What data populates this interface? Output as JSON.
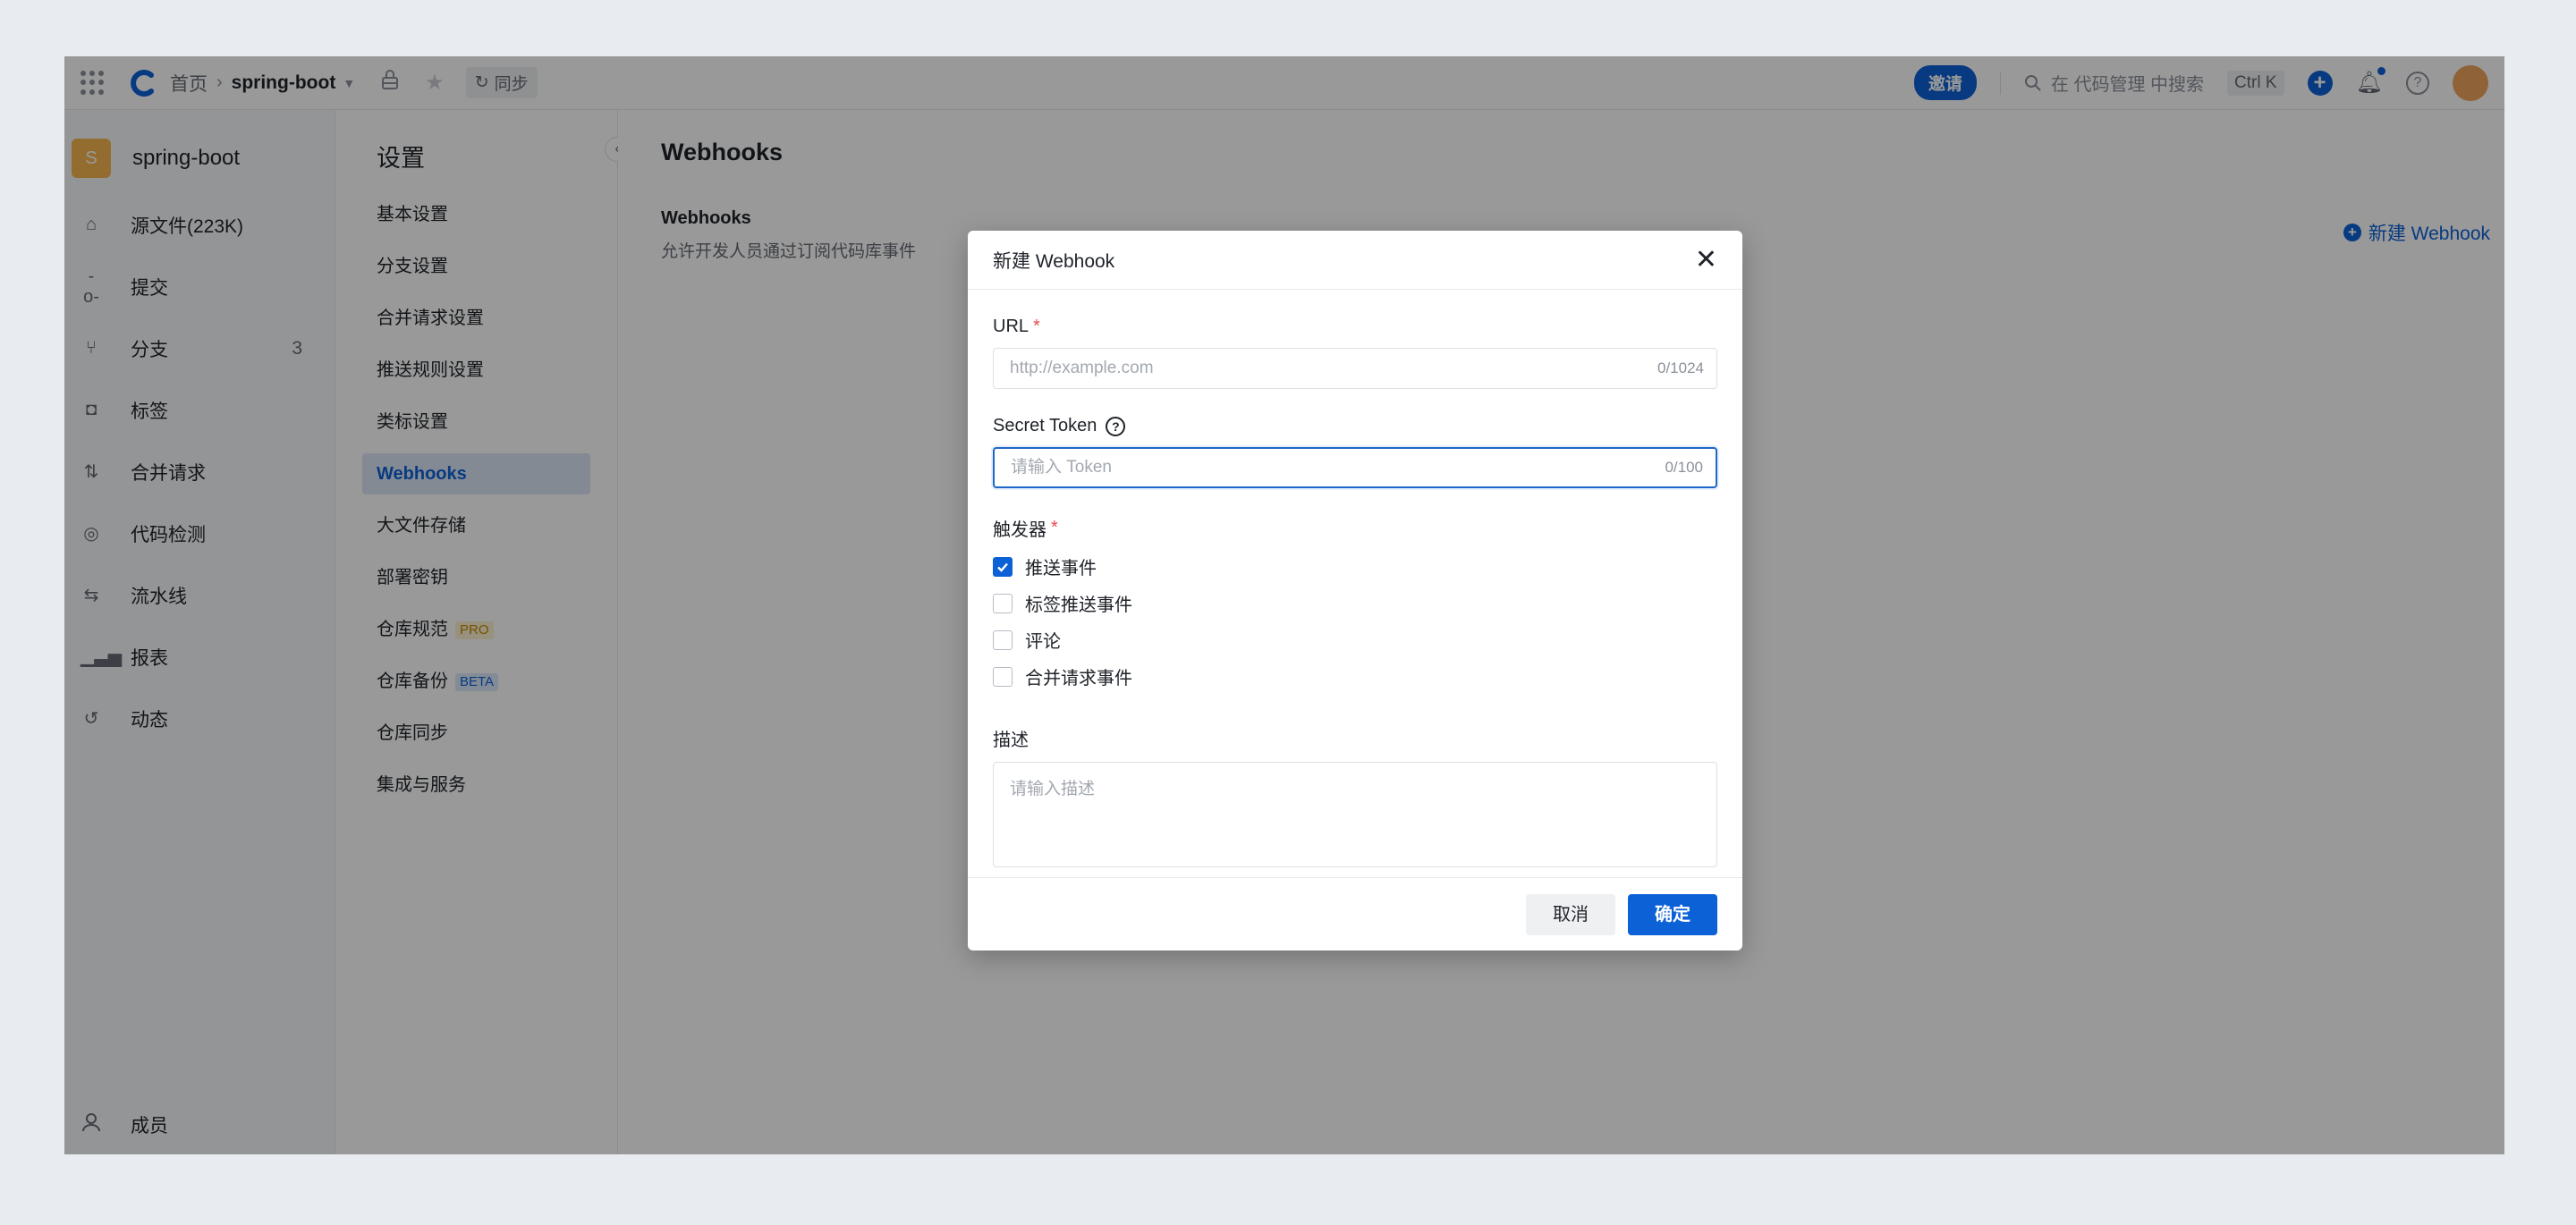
{
  "topbar": {
    "breadcrumb_home": "首页",
    "repo": "spring-boot",
    "sync_label": "同步",
    "invite_label": "邀请",
    "search_placeholder": "在 代码管理 中搜索",
    "shortcut": "Ctrl K"
  },
  "sidebar": {
    "repo_initial": "S",
    "repo_name": "spring-boot",
    "items": [
      {
        "label": "源文件(223K)",
        "icon": "home-icon"
      },
      {
        "label": "提交",
        "icon": "commit-icon"
      },
      {
        "label": "分支",
        "icon": "branch-icon",
        "count": "3"
      },
      {
        "label": "标签",
        "icon": "tag-icon"
      },
      {
        "label": "合并请求",
        "icon": "merge-request-icon"
      },
      {
        "label": "代码检测",
        "icon": "scan-icon"
      },
      {
        "label": "流水线",
        "icon": "pipeline-icon"
      },
      {
        "label": "报表",
        "icon": "chart-icon"
      },
      {
        "label": "动态",
        "icon": "history-icon"
      }
    ],
    "bottom_item": "成员"
  },
  "settings": {
    "title": "设置",
    "items": [
      {
        "label": "基本设置"
      },
      {
        "label": "分支设置"
      },
      {
        "label": "合并请求设置"
      },
      {
        "label": "推送规则设置"
      },
      {
        "label": "类标设置"
      },
      {
        "label": "Webhooks",
        "active": true
      },
      {
        "label": "大文件存储"
      },
      {
        "label": "部署密钥"
      },
      {
        "label": "仓库规范",
        "tag": "PRO"
      },
      {
        "label": "仓库备份",
        "tag": "BETA"
      },
      {
        "label": "仓库同步"
      },
      {
        "label": "集成与服务"
      }
    ]
  },
  "main": {
    "title": "Webhooks",
    "section_title": "Webhooks",
    "section_desc": "允许开发人员通过订阅代码库事件",
    "new_webhook_label": "新建 Webhook"
  },
  "modal": {
    "title": "新建 Webhook",
    "url_label": "URL",
    "url_placeholder": "http://example.com",
    "url_counter": "0/1024",
    "token_label": "Secret Token",
    "token_placeholder": "请输入 Token",
    "token_counter": "0/100",
    "trigger_label": "触发器",
    "triggers": [
      {
        "label": "推送事件",
        "checked": true
      },
      {
        "label": "标签推送事件",
        "checked": false
      },
      {
        "label": "评论",
        "checked": false
      },
      {
        "label": "合并请求事件",
        "checked": false
      }
    ],
    "desc_label": "描述",
    "desc_placeholder": "请输入描述",
    "cancel_label": "取消",
    "ok_label": "确定"
  },
  "colors": {
    "accent": "#0d61d6",
    "required": "#e5484d",
    "repo_badge": "#f6b64f"
  }
}
